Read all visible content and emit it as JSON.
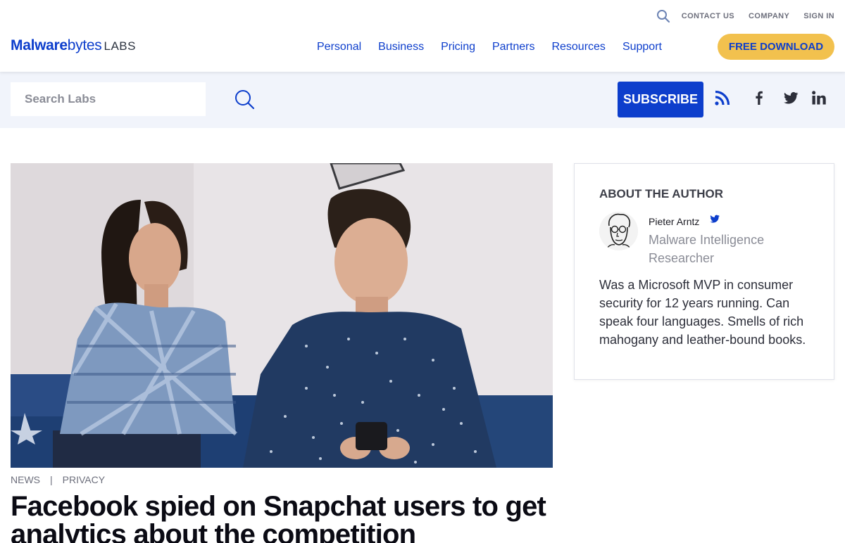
{
  "colors": {
    "brand": "#0d3ecc",
    "cta": "#f2c14e",
    "band": "#f1f4fb"
  },
  "header": {
    "utility_links": [
      "CONTACT US",
      "COMPANY",
      "SIGN IN"
    ],
    "logo": {
      "mal": "Malware",
      "bytes": "bytes",
      "labs": "LABS"
    },
    "nav": [
      "Personal",
      "Business",
      "Pricing",
      "Partners",
      "Resources",
      "Support"
    ],
    "cta": "FREE DOWNLOAD"
  },
  "search": {
    "placeholder": "Search Labs"
  },
  "subscribe": {
    "label": "SUBSCRIBE"
  },
  "social_icons": [
    "rss-icon",
    "facebook-icon",
    "twitter-icon",
    "linkedin-icon"
  ],
  "article": {
    "categories": [
      "NEWS",
      "PRIVACY"
    ],
    "separator": "|",
    "title": "Facebook spied on Snapchat users to get analytics about the competition"
  },
  "author": {
    "heading": "ABOUT THE AUTHOR",
    "name": "Pieter Arntz",
    "role": "Malware Intelligence Researcher",
    "bio": "Was a Microsoft MVP in consumer security for 12 years running. Can speak four languages. Smells of rich mahogany and leather-bound books."
  }
}
